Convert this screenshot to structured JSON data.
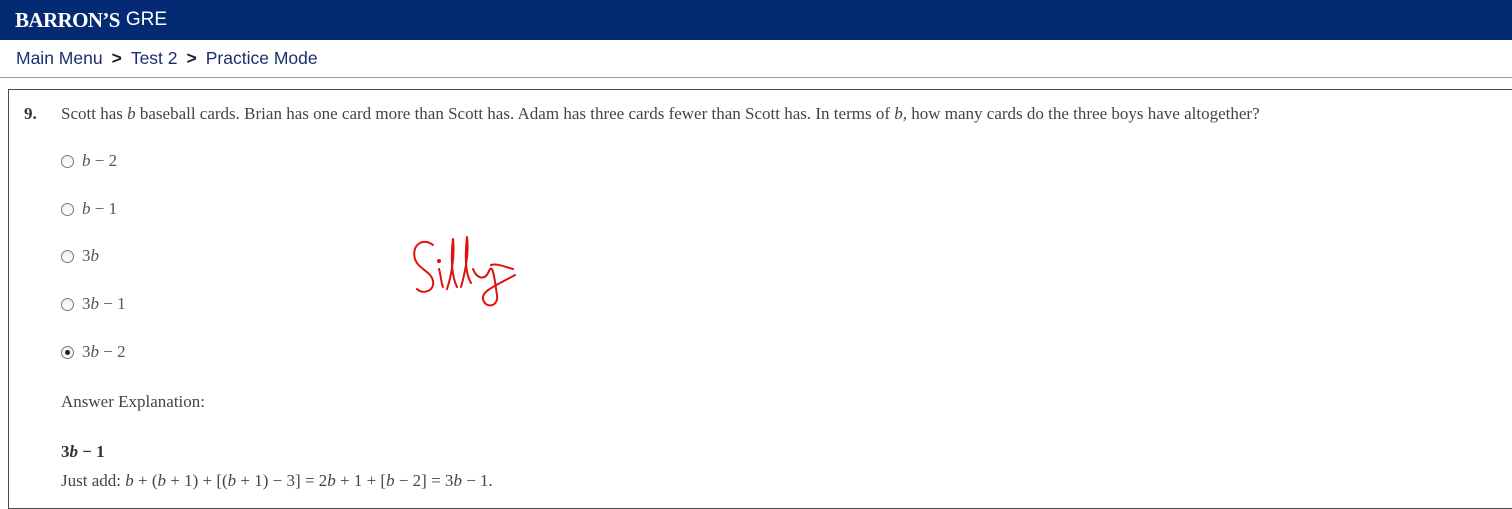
{
  "header": {
    "brand": "BARRON’S",
    "product": "GRE"
  },
  "breadcrumb": {
    "items": [
      "Main Menu",
      "Test 2",
      "Practice Mode"
    ],
    "separator": ">"
  },
  "question": {
    "number": "9.",
    "text": "Scott has b baseball cards. Brian has one card more than Scott has. Adam has three cards fewer than Scott has. In terms of b, how many cards do the three boys have altogether?",
    "options": [
      {
        "label": "b − 2",
        "selected": false
      },
      {
        "label": "b − 1",
        "selected": false
      },
      {
        "label": "3b",
        "selected": false
      },
      {
        "label": "3b − 1",
        "selected": false
      },
      {
        "label": "3b − 2",
        "selected": true
      }
    ]
  },
  "explanation": {
    "heading": "Answer Explanation:",
    "answer": "3b − 1",
    "text": "Just add: b + (b + 1) + [(b + 1) − 3] = 2b + 1 + [b − 2] = 3b − 1."
  },
  "annotation": {
    "handwriting": "Silly",
    "color": "#e01010"
  },
  "colors": {
    "header_bg": "#042a73",
    "nav_text": "#1a2f6e"
  }
}
